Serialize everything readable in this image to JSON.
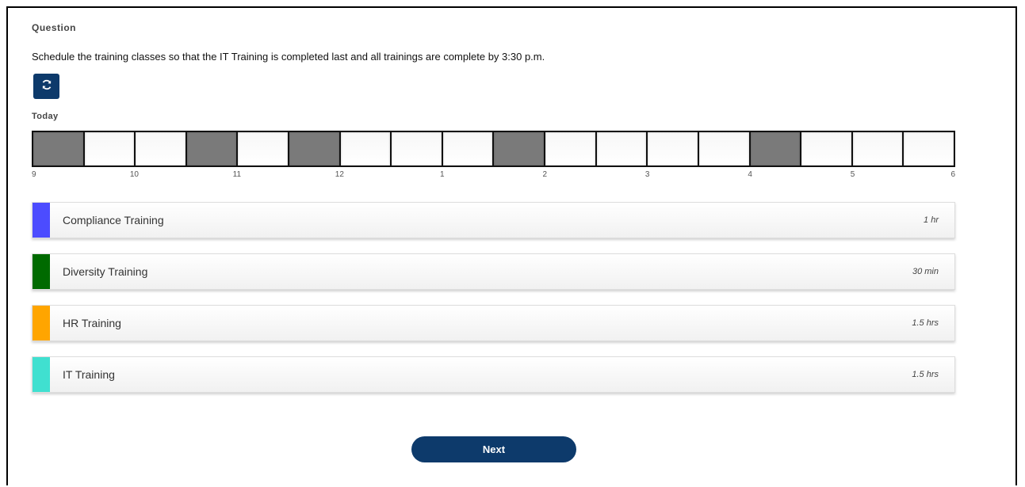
{
  "question": {
    "label": "Question",
    "text": "Schedule the training classes so that the IT Training is completed last and all trainings are complete by 3:30 p.m."
  },
  "reset_icon": "refresh-icon",
  "schedule": {
    "day_label": "Today",
    "slots": [
      true,
      false,
      false,
      true,
      false,
      true,
      false,
      false,
      false,
      true,
      false,
      false,
      false,
      false,
      true,
      false,
      false,
      false
    ],
    "ticks": [
      "9",
      "10",
      "11",
      "12",
      "1",
      "2",
      "3",
      "4",
      "5",
      "6"
    ]
  },
  "tasks": [
    {
      "name": "Compliance Training",
      "duration": "1 hr",
      "color": "#4c4cff"
    },
    {
      "name": "Diversity Training",
      "duration": "30 min",
      "color": "#006a00"
    },
    {
      "name": "HR Training",
      "duration": "1.5 hrs",
      "color": "#ffa500"
    },
    {
      "name": "IT Training",
      "duration": "1.5 hrs",
      "color": "#40e0d0"
    }
  ],
  "next_label": "Next"
}
